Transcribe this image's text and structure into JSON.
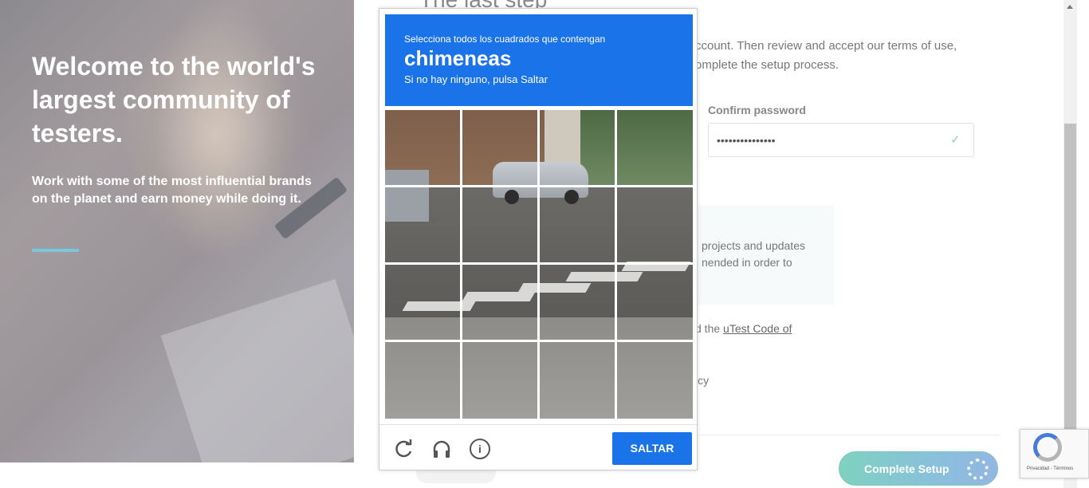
{
  "hero": {
    "heading": "Welcome to the world's largest community of testers.",
    "subtext": "Work with some of the most influential brands on the planet and earn money while doing it."
  },
  "form": {
    "title": "The last step",
    "intro": "ccount. Then review and accept our terms of use, omplete the setup process.",
    "confirm_password_label": "Confirm password",
    "confirm_password_value": "•••••••••••••••",
    "info_text": "projects and updates nended in order to",
    "code_prefix": "d the ",
    "code_link": "uTest Code of",
    "privacy_fragment": "icy",
    "complete_button": "Complete Setup"
  },
  "captcha": {
    "instruction": "Selecciona todos los cuadrados que contengan",
    "target": "chimeneas",
    "subtext": "Si no hay ninguno, pulsa Saltar",
    "skip_button": "SALTAR",
    "icons": [
      "reload-icon",
      "headphones-icon",
      "info-icon"
    ],
    "grid_rows": 4,
    "grid_cols": 4
  },
  "recaptcha_badge": {
    "text": "Privacidad - Términos"
  },
  "colors": {
    "captcha_blue": "#1a73e8",
    "accent_line": "#7cc6dd",
    "complete_btn_start": "#7fd2bf",
    "complete_btn_end": "#93b6e2"
  }
}
